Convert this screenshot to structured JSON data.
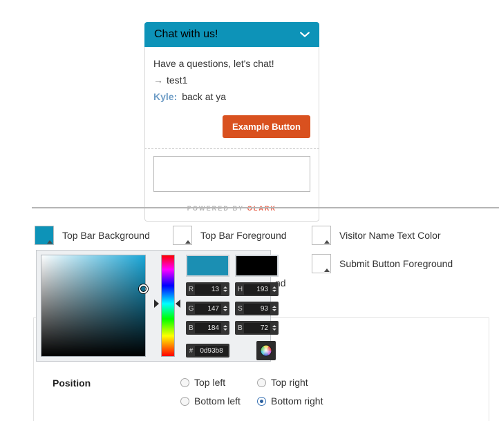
{
  "chat": {
    "header_title": "Chat with us!",
    "collapse_icon": "chevron-down-icon",
    "header_bg": "#0d93b8",
    "greeting": "Have a questions, let's chat!",
    "messages": [
      {
        "prefix": "→",
        "who": "",
        "text": "test1"
      },
      {
        "prefix": "",
        "who": "Kyle:",
        "text": "back at ya"
      }
    ],
    "example_button_label": "Example Button",
    "example_button_bg": "#d9511f",
    "input_placeholder": "",
    "input_value": "",
    "footer_prefix": "POWERED BY",
    "footer_brand": "OLARK",
    "footer_brand_color": "#e8573f"
  },
  "swatches": [
    {
      "label": "Top Bar Background",
      "color": "#0d93b8",
      "icon": "color-swatch-caret"
    },
    {
      "label": "Top Bar Foreground",
      "color": "#ffffff",
      "icon": "color-swatch-caret"
    },
    {
      "label": "Visitor Name Text Color",
      "color": "#ffffff",
      "icon": "color-swatch-caret"
    },
    {
      "label": "Submit Button Foreground",
      "color": "#ffffff",
      "icon": "color-swatch-caret"
    }
  ],
  "obscured_label": "nd",
  "picker": {
    "preview_new": "#1b8fb3",
    "preview_old": "#000000",
    "cursor_icon": "sv-cursor-icon",
    "hue_marker_icon": "hue-marker-icon",
    "wheel_icon": "color-wheel-icon",
    "fields": [
      {
        "label": "R",
        "value": "13"
      },
      {
        "label": "G",
        "value": "147"
      },
      {
        "label": "B",
        "value": "184"
      },
      {
        "label": "H",
        "value": "193"
      },
      {
        "label": "S",
        "value": "93"
      },
      {
        "label": "B",
        "value": "72"
      }
    ],
    "hex_label": "#",
    "hex_value": "0d93b8"
  },
  "position": {
    "label": "Position",
    "options": [
      {
        "label": "Top left",
        "selected": false
      },
      {
        "label": "Top right",
        "selected": false
      },
      {
        "label": "Bottom left",
        "selected": false
      },
      {
        "label": "Bottom right",
        "selected": true
      }
    ]
  }
}
